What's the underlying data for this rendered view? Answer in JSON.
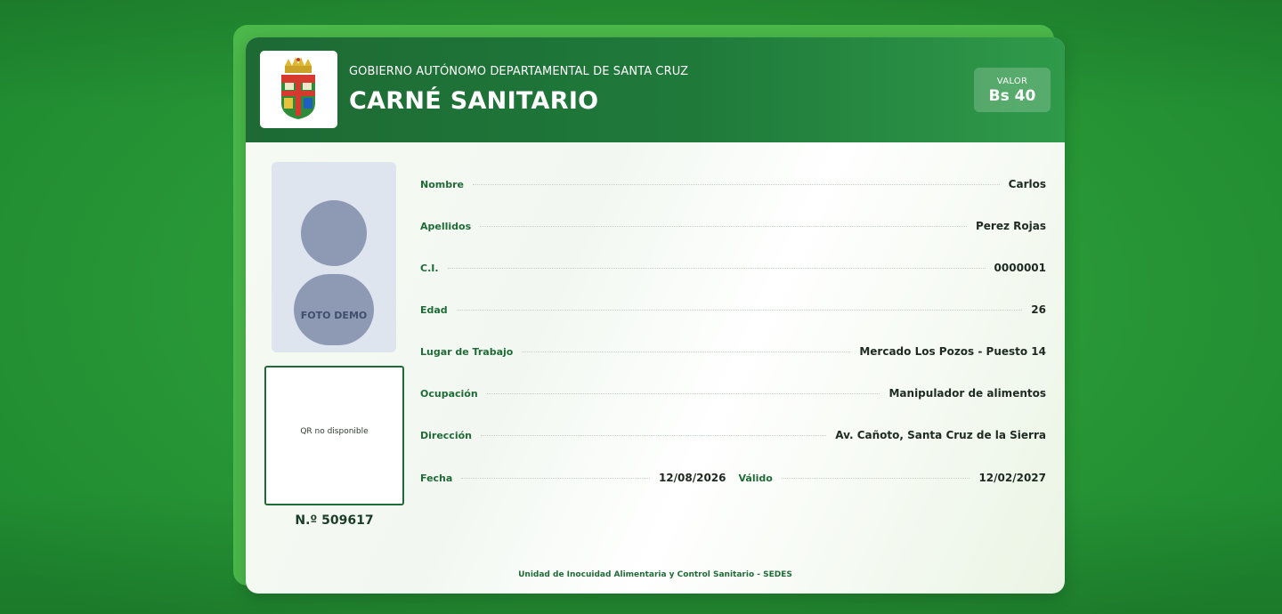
{
  "header": {
    "gov_title": "GOBIERNO AUTÓNOMO DEPARTAMENTAL DE SANTA CRUZ",
    "main_title": "CARNÉ SANITARIO",
    "valor_label": "VALOR",
    "valor_amount": "Bs 40"
  },
  "photo": {
    "label": "FOTO DEMO"
  },
  "qr": {
    "text": "QR no disponible"
  },
  "card_number": "N.º 509617",
  "fields": [
    {
      "label": "Nombre",
      "value": "Carlos"
    },
    {
      "label": "Apellidos",
      "value": "Perez Rojas"
    },
    {
      "label": "C.I.",
      "value": "0000001"
    },
    {
      "label": "Edad",
      "value": "26"
    },
    {
      "label": "Lugar de Trabajo",
      "value": "Mercado Los Pozos - Puesto 14"
    },
    {
      "label": "Ocupación",
      "value": "Manipulador de alimentos"
    },
    {
      "label": "Dirección",
      "value": "Av. Cañoto, Santa Cruz de la Sierra"
    }
  ],
  "dates": {
    "fecha_label": "Fecha",
    "fecha_value": "12/08/2026",
    "valido_label": "Válido",
    "valido_value": "12/02/2027"
  },
  "footer": "Unidad de Inocuidad Alimentaria y Control Sanitario - SEDES",
  "colors": {
    "header_green": "#1d6a34",
    "background_green": "#2a9a38",
    "label_green": "#1f6b37",
    "photo_placeholder": "#8e99b4"
  }
}
